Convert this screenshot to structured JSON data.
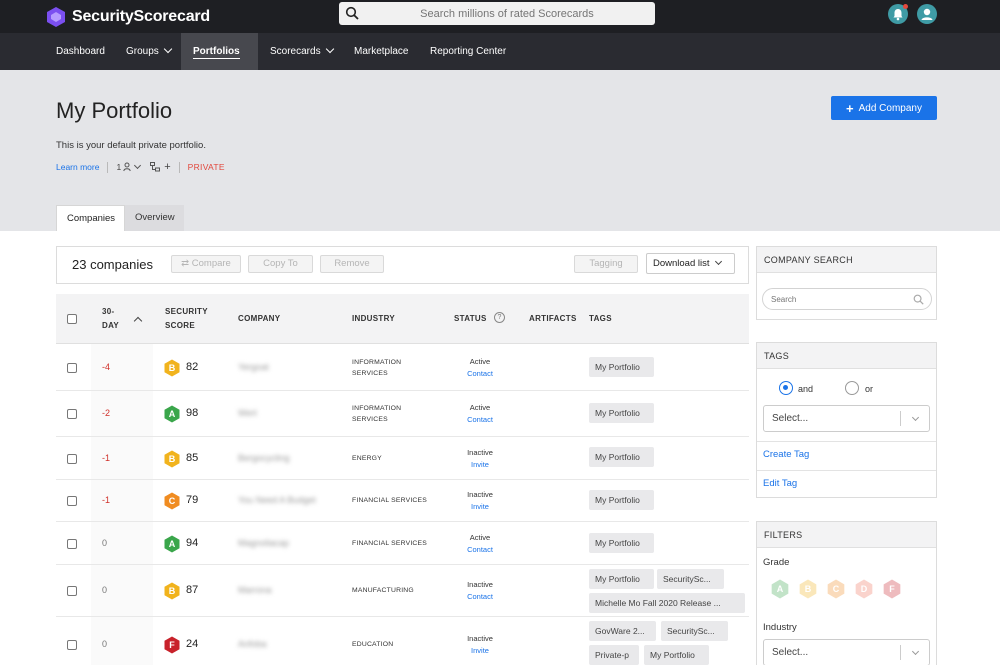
{
  "brand": {
    "name": "SecurityScorecard"
  },
  "search": {
    "placeholder": "Search millions of rated Scorecards"
  },
  "nav": {
    "dashboard": "Dashboard",
    "groups": "Groups",
    "portfolios": "Portfolios",
    "scorecards": "Scorecards",
    "marketplace": "Marketplace",
    "reporting": "Reporting Center"
  },
  "header": {
    "title": "My Portfolio",
    "add_company": "Add Company",
    "description": "This is your default private portfolio.",
    "learn_more": "Learn more",
    "members_count": "1",
    "visibility": "PRIVATE",
    "tabs": [
      "Companies",
      "Overview"
    ]
  },
  "toolbar": {
    "count": "23 companies",
    "compare": "Compare",
    "copy_to": "Copy To",
    "remove": "Remove",
    "tagging": "Tagging",
    "download": "Download list"
  },
  "table": {
    "headers": {
      "day_line1": "30-",
      "day_line2": "DAY",
      "score_line1": "SECURITY",
      "score_line2": "SCORE",
      "company": "COMPANY",
      "industry": "INDUSTRY",
      "status": "STATUS",
      "help": "?",
      "artifacts": "ARTIFACTS",
      "tags": "TAGS"
    },
    "rows": [
      {
        "delta": "-4",
        "grade": "B",
        "score": "82",
        "company": "Yergoat",
        "industry_1": "INFORMATION",
        "industry_2": "SERVICES",
        "status": "Active",
        "action": "Contact",
        "tags": [
          "My Portfolio"
        ]
      },
      {
        "delta": "-2",
        "grade": "A",
        "score": "98",
        "company": "Wert",
        "industry_1": "INFORMATION",
        "industry_2": "SERVICES",
        "status": "Active",
        "action": "Contact",
        "tags": [
          "My Portfolio"
        ]
      },
      {
        "delta": "-1",
        "grade": "B",
        "score": "85",
        "company": "Bergocycling",
        "industry_1": "ENERGY",
        "industry_2": "",
        "status": "Inactive",
        "action": "Invite",
        "tags": [
          "My Portfolio"
        ]
      },
      {
        "delta": "-1",
        "grade": "C",
        "score": "79",
        "company": "You Need A Budget",
        "industry_1": "FINANCIAL SERVICES",
        "industry_2": "",
        "status": "Inactive",
        "action": "Invite",
        "tags": [
          "My Portfolio"
        ]
      },
      {
        "delta": "0",
        "grade": "A",
        "score": "94",
        "company": "Magnoliacap",
        "industry_1": "FINANCIAL SERVICES",
        "industry_2": "",
        "status": "Active",
        "action": "Contact",
        "tags": [
          "My Portfolio"
        ]
      },
      {
        "delta": "0",
        "grade": "B",
        "score": "87",
        "company": "Marrona",
        "industry_1": "MANUFACTURING",
        "industry_2": "",
        "status": "Inactive",
        "action": "Contact",
        "tags": [
          "My Portfolio",
          "SecuritySc...",
          "Michelle Mo Fall 2020 Release ..."
        ]
      },
      {
        "delta": "0",
        "grade": "F",
        "score": "24",
        "company": "Anfoba",
        "industry_1": "EDUCATION",
        "industry_2": "",
        "status": "Inactive",
        "action": "Invite",
        "tags": [
          "GovWare 2...",
          "SecuritySc...",
          "Private-p",
          "My Portfolio"
        ]
      }
    ]
  },
  "sidebar": {
    "company_search": {
      "title": "COMPANY SEARCH",
      "placeholder": "Search"
    },
    "tags": {
      "title": "TAGS",
      "and": "and",
      "or": "or",
      "select": "Select...",
      "create": "Create Tag",
      "edit": "Edit Tag"
    },
    "filters": {
      "title": "FILTERS",
      "grade": "Grade",
      "grades": [
        "A",
        "B",
        "C",
        "D",
        "F"
      ],
      "industry": "Industry",
      "select": "Select..."
    }
  },
  "colors": {
    "A": "#3aa64b",
    "B": "#f1b31d",
    "C": "#f08c21",
    "D": "#ef6f5a",
    "F": "#c8222b",
    "accent": "#1a73e8"
  }
}
